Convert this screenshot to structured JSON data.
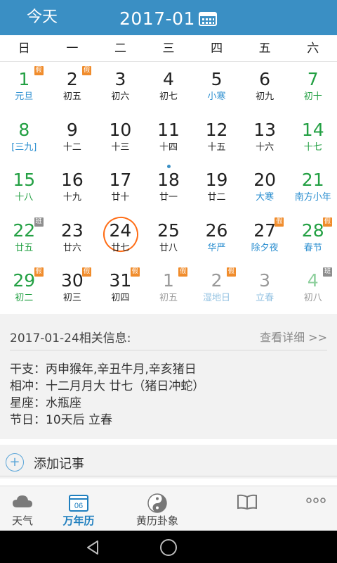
{
  "header": {
    "today": "今天",
    "month": "2017-01"
  },
  "weekdays": [
    "日",
    "一",
    "二",
    "三",
    "四",
    "五",
    "六"
  ],
  "days": [
    {
      "d": "1",
      "l": "元旦",
      "dc": "green",
      "lc": "blue",
      "badge": "假"
    },
    {
      "d": "2",
      "l": "初五",
      "dc": "",
      "lc": "",
      "badge": "假"
    },
    {
      "d": "3",
      "l": "初六",
      "dc": "",
      "lc": "",
      "badge": ""
    },
    {
      "d": "4",
      "l": "初七",
      "dc": "",
      "lc": "",
      "badge": ""
    },
    {
      "d": "5",
      "l": "小寒",
      "dc": "",
      "lc": "blue",
      "badge": ""
    },
    {
      "d": "6",
      "l": "初九",
      "dc": "",
      "lc": "",
      "badge": ""
    },
    {
      "d": "7",
      "l": "初十",
      "dc": "green",
      "lc": "green",
      "badge": ""
    },
    {
      "d": "8",
      "l": "[三九]",
      "dc": "green",
      "lc": "blue",
      "badge": ""
    },
    {
      "d": "9",
      "l": "十二",
      "dc": "",
      "lc": "",
      "badge": ""
    },
    {
      "d": "10",
      "l": "十三",
      "dc": "",
      "lc": "",
      "badge": ""
    },
    {
      "d": "11",
      "l": "十四",
      "dc": "",
      "lc": "",
      "badge": ""
    },
    {
      "d": "12",
      "l": "十五",
      "dc": "",
      "lc": "",
      "badge": ""
    },
    {
      "d": "13",
      "l": "十六",
      "dc": "",
      "lc": "",
      "badge": ""
    },
    {
      "d": "14",
      "l": "十七",
      "dc": "green",
      "lc": "green",
      "badge": ""
    },
    {
      "d": "15",
      "l": "十八",
      "dc": "green",
      "lc": "green",
      "badge": ""
    },
    {
      "d": "16",
      "l": "十九",
      "dc": "",
      "lc": "",
      "badge": ""
    },
    {
      "d": "17",
      "l": "廿十",
      "dc": "",
      "lc": "",
      "badge": ""
    },
    {
      "d": "18",
      "l": "廿一",
      "dc": "",
      "lc": "",
      "badge": "",
      "dot": true
    },
    {
      "d": "19",
      "l": "廿二",
      "dc": "",
      "lc": "",
      "badge": ""
    },
    {
      "d": "20",
      "l": "大寒",
      "dc": "",
      "lc": "blue",
      "badge": ""
    },
    {
      "d": "21",
      "l": "南方小年",
      "dc": "green",
      "lc": "blue",
      "badge": ""
    },
    {
      "d": "22",
      "l": "廿五",
      "dc": "green",
      "lc": "green",
      "badge": "班"
    },
    {
      "d": "23",
      "l": "廿六",
      "dc": "",
      "lc": "",
      "badge": ""
    },
    {
      "d": "24",
      "l": "廿七",
      "dc": "",
      "lc": "",
      "badge": "",
      "selected": true
    },
    {
      "d": "25",
      "l": "廿八",
      "dc": "",
      "lc": "",
      "badge": ""
    },
    {
      "d": "26",
      "l": "华严",
      "dc": "",
      "lc": "blue",
      "badge": ""
    },
    {
      "d": "27",
      "l": "除夕夜",
      "dc": "",
      "lc": "blue",
      "badge": "假"
    },
    {
      "d": "28",
      "l": "春节",
      "dc": "green",
      "lc": "blue",
      "badge": "假"
    },
    {
      "d": "29",
      "l": "初二",
      "dc": "green",
      "lc": "green",
      "badge": "假"
    },
    {
      "d": "30",
      "l": "初三",
      "dc": "",
      "lc": "",
      "badge": "假"
    },
    {
      "d": "31",
      "l": "初四",
      "dc": "",
      "lc": "",
      "badge": "假"
    },
    {
      "d": "1",
      "l": "初五",
      "dc": "gray",
      "lc": "gray",
      "badge": "假"
    },
    {
      "d": "2",
      "l": "湿地日",
      "dc": "gray",
      "lc": "faint-blue",
      "badge": "假"
    },
    {
      "d": "3",
      "l": "立春",
      "dc": "gray",
      "lc": "faint-blue",
      "badge": ""
    },
    {
      "d": "4",
      "l": "初八",
      "dc": "faint-green",
      "lc": "gray",
      "badge": "班"
    }
  ],
  "info": {
    "title": "2017-01-24相关信息:",
    "more": "查看详细 >>",
    "rows": [
      "干支：丙申猴年,辛丑牛月,辛亥猪日",
      "相冲：十二月月大 廿七（猪日冲蛇）",
      "星座：水瓶座",
      "节日：10天后 立春"
    ]
  },
  "add": {
    "icon": "plus-circle-icon",
    "label": "添加记事"
  },
  "tabs": [
    {
      "label": "天气",
      "icon": "cloud-icon"
    },
    {
      "label": "万年历",
      "icon": "calendar-icon",
      "day": "06"
    },
    {
      "label": "黄历卦象",
      "icon": "yinyang-icon"
    },
    {
      "label": "",
      "icon": "book-icon"
    },
    {
      "label": "",
      "icon": "more-icon"
    }
  ],
  "colors": {
    "header": "#3a8fc4",
    "green": "#23a043",
    "blue": "#2c8fd0",
    "badge_rest": "#f08c2c",
    "badge_work": "#8e8e8e",
    "selected": "#ff6d16"
  }
}
